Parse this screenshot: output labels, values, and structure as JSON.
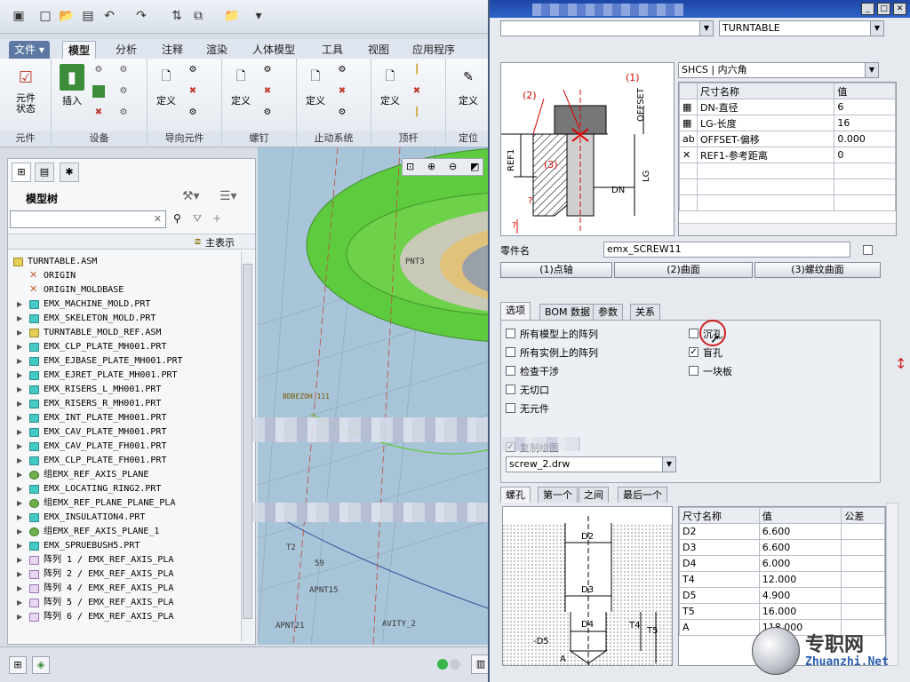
{
  "ribbon": {
    "tabs": [
      "文件 ▾",
      "模型",
      "分析",
      "注释",
      "渲染",
      "人体模型",
      "工具",
      "视图",
      "应用程序"
    ],
    "groups": [
      {
        "label": "元件",
        "buttons": [
          "元件\n状态"
        ]
      },
      {
        "label": "设备",
        "buttons": [
          "插入"
        ]
      },
      {
        "label": "导向元件",
        "buttons": [
          "定义"
        ]
      },
      {
        "label": "螺钉",
        "buttons": [
          "定义"
        ]
      },
      {
        "label": "止动系统",
        "buttons": [
          "定义"
        ]
      },
      {
        "label": "顶杆",
        "buttons": [
          "定义"
        ]
      },
      {
        "label": "定位",
        "buttons": [
          "定义"
        ]
      }
    ]
  },
  "tree": {
    "title": "模型树",
    "main_display": "主表示",
    "items": [
      {
        "label": "TURNTABLE.ASM",
        "type": "asm",
        "toggle": ""
      },
      {
        "label": "ORIGIN",
        "type": "dtm",
        "toggle": ""
      },
      {
        "label": "ORIGIN_MOLDBASE",
        "type": "dtm",
        "toggle": ""
      },
      {
        "label": "EMX_MACHINE_MOLD.PRT",
        "type": "prt",
        "toggle": "▶"
      },
      {
        "label": "EMX_SKELETON_MOLD.PRT",
        "type": "prt",
        "toggle": "▶"
      },
      {
        "label": "TURNTABLE_MOLD_REF.ASM",
        "type": "asm",
        "toggle": "▶"
      },
      {
        "label": "EMX_CLP_PLATE_MH001.PRT",
        "type": "prt",
        "toggle": "▶"
      },
      {
        "label": "EMX_EJBASE_PLATE_MH001.PRT",
        "type": "prt",
        "toggle": "▶"
      },
      {
        "label": "EMX_EJRET_PLATE_MH001.PRT",
        "type": "prt",
        "toggle": "▶"
      },
      {
        "label": "EMX_RISERS_L_MH001.PRT",
        "type": "prt",
        "toggle": "▶"
      },
      {
        "label": "EMX_RISERS_R_MH001.PRT",
        "type": "prt",
        "toggle": "▶"
      },
      {
        "label": "EMX_INT_PLATE_MH001.PRT",
        "type": "prt",
        "toggle": "▶"
      },
      {
        "label": "EMX_CAV_PLATE_MH001.PRT",
        "type": "prt",
        "toggle": "▶"
      },
      {
        "label": "EMX_CAV_PLATE_FH001.PRT",
        "type": "prt",
        "toggle": "▶"
      },
      {
        "label": "EMX_CLP_PLATE_FH001.PRT",
        "type": "prt",
        "toggle": "▶"
      },
      {
        "label": "组EMX_REF_AXIS_PLANE",
        "type": "grp",
        "toggle": "▶"
      },
      {
        "label": "EMX_LOCATING_RING2.PRT",
        "type": "prt",
        "toggle": "▶"
      },
      {
        "label": "组EMX_REF_PLANE_PLANE_PLA",
        "type": "grp",
        "toggle": "▶"
      },
      {
        "label": "EMX_INSULATION4.PRT",
        "type": "prt",
        "toggle": "▶"
      },
      {
        "label": "组EMX_REF_AXIS_PLANE_1",
        "type": "grp",
        "toggle": "▶"
      },
      {
        "label": "EMX_SPRUEBUSH5.PRT",
        "type": "prt",
        "toggle": "▶"
      },
      {
        "label": "阵列 1 / EMX_REF_AXIS_PLA",
        "type": "pat",
        "toggle": "▶"
      },
      {
        "label": "阵列 2 / EMX_REF_AXIS_PLA",
        "type": "pat",
        "toggle": "▶"
      },
      {
        "label": "阵列 4 / EMX_REF_AXIS_PLA",
        "type": "pat",
        "toggle": "▶"
      },
      {
        "label": "阵列 5 / EMX_REF_AXIS_PLA",
        "type": "pat",
        "toggle": "▶"
      },
      {
        "label": "阵列 6 / EMX_REF_AXIS_PLA",
        "type": "pat",
        "toggle": "▶"
      }
    ]
  },
  "viewport": {
    "labels": [
      "PNT3",
      "BDBEZOH_111",
      "APNT15",
      "AVITY_2",
      "APNT21",
      "T2",
      "59"
    ]
  },
  "dialog": {
    "top_combo": "TURNTABLE",
    "diagram_labels": {
      "c1": "(1)",
      "c2": "(2)",
      "c3": "(3)",
      "offset": "OFFSET",
      "ref1": "REF1",
      "lg": "LG",
      "dn": "DN",
      "q": "?"
    },
    "type_combo": "SHCS | 内六角",
    "dim_table": {
      "headers": [
        "尺寸名称",
        "值"
      ],
      "rows": [
        {
          "icon": "▦",
          "name": "DN-直径",
          "value": "6"
        },
        {
          "icon": "▦",
          "name": "LG-长度",
          "value": "16"
        },
        {
          "icon": "ab",
          "name": "OFFSET-偏移",
          "value": "0.000"
        },
        {
          "icon": "✕",
          "name": "REF1-参考距离",
          "value": "0"
        }
      ]
    },
    "part_name_label": "零件名",
    "part_name": "emx_SCREW11",
    "ref_buttons": [
      "(1)点轴",
      "(2)曲面",
      "(3)螺纹曲面"
    ],
    "tabs": [
      "选项",
      "BOM 数据",
      "参数",
      "关系"
    ],
    "options_left": [
      {
        "label": "所有模型上的阵列",
        "checked": false
      },
      {
        "label": "所有实例上的阵列",
        "checked": false
      },
      {
        "label": "检查干涉",
        "checked": false
      },
      {
        "label": "无切口",
        "checked": false
      },
      {
        "label": "无元件",
        "checked": false
      }
    ],
    "options_right": [
      {
        "label": "沉孔",
        "checked": false
      },
      {
        "label": "盲孔",
        "checked": true
      },
      {
        "label": "一块板",
        "checked": false
      }
    ],
    "drawing_label": "复制绘图",
    "drawing_combo": "screw_2.drw",
    "lower_tabs": [
      "螺孔",
      "第一个",
      "之间",
      "最后一个"
    ],
    "hole_labels": {
      "d2": "D2",
      "d3": "D3",
      "d4": "D4",
      "d5": "-D5",
      "t4": "T4",
      "t5": "T5",
      "a": "A"
    },
    "hole_table": {
      "headers": [
        "尺寸名称",
        "值",
        "公差"
      ],
      "rows": [
        {
          "name": "D2",
          "value": "6.600",
          "tol": ""
        },
        {
          "name": "D3",
          "value": "6.600",
          "tol": ""
        },
        {
          "name": "D4",
          "value": "6.000",
          "tol": ""
        },
        {
          "name": "T4",
          "value": "12.000",
          "tol": ""
        },
        {
          "name": "D5",
          "value": "4.900",
          "tol": ""
        },
        {
          "name": "T5",
          "value": "16.000",
          "tol": ""
        },
        {
          "name": "A",
          "value": "118.000",
          "tol": ""
        }
      ]
    }
  },
  "watermark": {
    "cn": "专职网",
    "url": "Zhuanzhi.Net"
  },
  "colors": {
    "tree_prt": "#45c9c4",
    "title_bar": "#1d46a6",
    "ring_green": "#5ecb3e"
  }
}
